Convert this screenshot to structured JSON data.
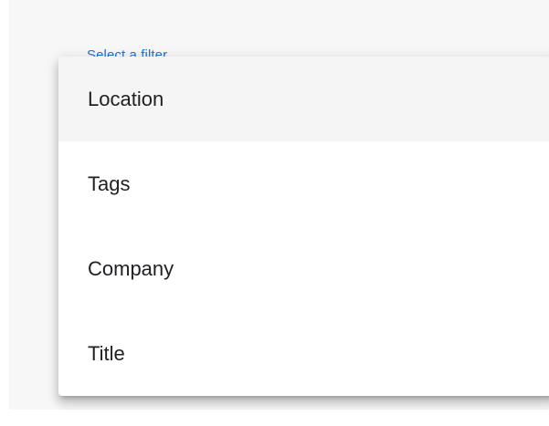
{
  "filter": {
    "label": "Select a filter"
  },
  "dropdown": {
    "selected_index": 0,
    "options": [
      {
        "label": "Location"
      },
      {
        "label": "Tags"
      },
      {
        "label": "Company"
      },
      {
        "label": "Title"
      }
    ]
  },
  "colors": {
    "accent": "#1a73e8",
    "selected_bg": "#f5f5f5",
    "text": "#202124"
  }
}
